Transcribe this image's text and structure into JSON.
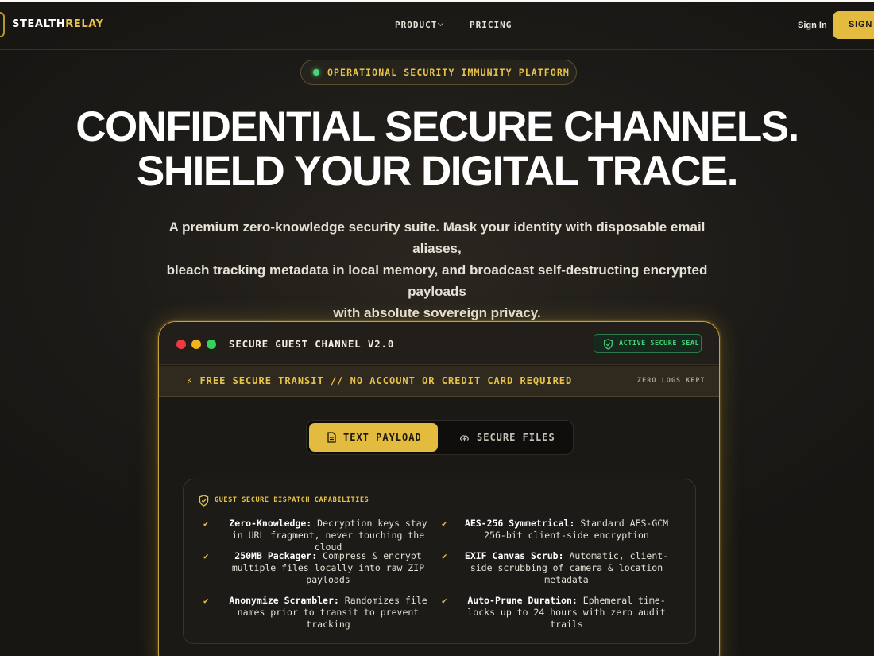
{
  "nav": {
    "logo_part1": "STEALTH",
    "logo_part2": "RELAY",
    "links": [
      {
        "label": "PRODUCT",
        "has_dropdown": true
      },
      {
        "label": "PRICING",
        "has_dropdown": false
      }
    ],
    "signin_label": "Sign In",
    "signup_label": "SIGN U"
  },
  "hero": {
    "badge": "OPERATIONAL SECURITY IMMUNITY PLATFORM",
    "title_line1": "CONFIDENTIAL SECURE CHANNELS.",
    "title_line2": "SHIELD YOUR DIGITAL TRACE.",
    "subtitle_line1": "A premium zero-knowledge security suite. Mask your identity with disposable email aliases,",
    "subtitle_line2": "bleach tracking metadata in local memory, and broadcast self-destructing encrypted payloads",
    "subtitle_line3": "with absolute sovereign privacy."
  },
  "card": {
    "title": "SECURE GUEST CHANNEL V2.0",
    "seal": "ACTIVE SECURE SEAL",
    "banner": "⚡ FREE SECURE TRANSIT // NO ACCOUNT OR CREDIT CARD REQUIRED",
    "banner_right": "ZERO LOGS KEPT",
    "tabs": [
      {
        "label": "TEXT PAYLOAD",
        "active": true,
        "icon": "document-icon"
      },
      {
        "label": "SECURE FILES",
        "active": false,
        "icon": "cloud-upload-icon"
      }
    ],
    "capabilities": {
      "heading": "GUEST SECURE DISPATCH CAPABILITIES",
      "items": [
        {
          "title": "Zero-Knowledge:",
          "text": "Decryption keys stay in URL fragment, never touching the cloud"
        },
        {
          "title": "AES-256 Symmetrical:",
          "text": "Standard AES-GCM 256-bit client-side encryption"
        },
        {
          "title": "250MB Packager:",
          "text": "Compress & encrypt multiple files locally into raw ZIP payloads"
        },
        {
          "title": "EXIF Canvas Scrub:",
          "text": "Automatic, client-side scrubbing of camera & location metadata"
        },
        {
          "title": "Anonymize Scrambler:",
          "text": "Randomizes file names prior to transit to prevent tracking"
        },
        {
          "title": "Auto-Prune Duration:",
          "text": "Ephemeral time-locks up to 24 hours with zero audit trails"
        }
      ]
    }
  },
  "colors": {
    "accent": "#e2bb3f",
    "background": "#1b1916",
    "success": "#45d47c"
  }
}
